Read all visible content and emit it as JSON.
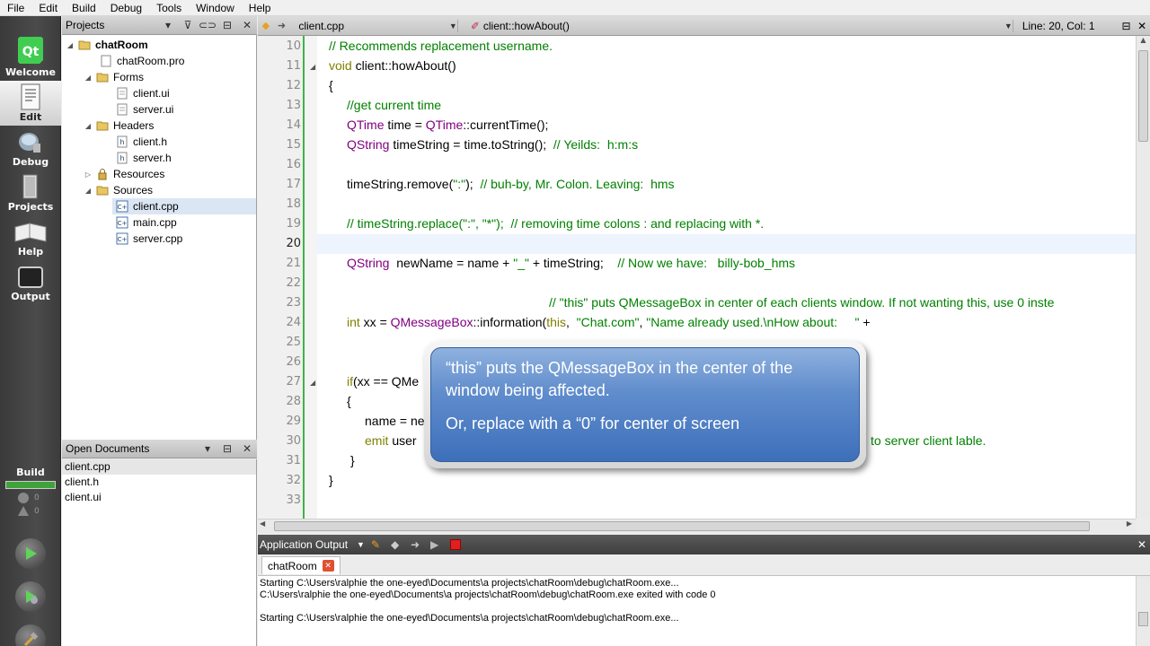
{
  "menu": [
    "File",
    "Edit",
    "Build",
    "Debug",
    "Tools",
    "Window",
    "Help"
  ],
  "modes": [
    {
      "label": "Welcome",
      "icon": "qt-logo-icon"
    },
    {
      "label": "Edit",
      "icon": "edit-document-icon"
    },
    {
      "label": "Debug",
      "icon": "debug-bug-icon"
    },
    {
      "label": "Projects",
      "icon": "projects-icon"
    },
    {
      "label": "Help",
      "icon": "help-book-icon"
    },
    {
      "label": "Output",
      "icon": "output-monitor-icon"
    }
  ],
  "build": {
    "label": "Build",
    "warn_count": "0",
    "error_count": "0"
  },
  "projects_panel": {
    "title": "Projects",
    "tree": [
      {
        "label": "chatRoom"
      },
      {
        "label": "chatRoom.pro"
      },
      {
        "label": "Forms"
      },
      {
        "label": "client.ui"
      },
      {
        "label": "server.ui"
      },
      {
        "label": "Headers"
      },
      {
        "label": "client.h"
      },
      {
        "label": "server.h"
      },
      {
        "label": "Resources"
      },
      {
        "label": "Sources"
      },
      {
        "label": "client.cpp"
      },
      {
        "label": "main.cpp"
      },
      {
        "label": "server.cpp"
      }
    ]
  },
  "open_documents": {
    "title": "Open Documents",
    "items": [
      "client.cpp",
      "client.h",
      "client.ui"
    ]
  },
  "editor_toolbar": {
    "file": "client.cpp",
    "function": "client::howAbout()",
    "position": "Line: 20, Col: 1"
  },
  "editor": {
    "line_numbers": [
      "10",
      "11",
      "12",
      "13",
      "14",
      "15",
      "16",
      "17",
      "18",
      "19",
      "20",
      "21",
      "22",
      "23",
      "24",
      "25",
      "26",
      "27",
      "28",
      "29",
      "30",
      "31",
      "32",
      "33"
    ],
    "current_line": "20"
  },
  "callout": {
    "line1": "“this” puts the QMessageBox in the center of the window being affected.",
    "line2": "Or, replace with a “0” for center of screen"
  },
  "output": {
    "title": "Application Output",
    "tab": "chatRoom",
    "lines": [
      "Starting C:\\Users\\ralphie the one-eyed\\Documents\\a projects\\chatRoom\\debug\\chatRoom.exe...",
      "C:\\Users\\ralphie the one-eyed\\Documents\\a projects\\chatRoom\\debug\\chatRoom.exe exited with code 0",
      "",
      "Starting C:\\Users\\ralphie the one-eyed\\Documents\\a projects\\chatRoom\\debug\\chatRoom.exe..."
    ]
  },
  "code": {
    "l10": "// Recommends replacement username.",
    "l11a": "void",
    "l11b": " client::howAbout()",
    "l12": "{",
    "l13": "//get current time",
    "l14a": "QTime",
    "l14b": " time = ",
    "l14c": "QTime",
    "l14d": "::currentTime();",
    "l15a": "QString",
    "l15b": " timeString = time.toString();  ",
    "l15c": "// Yeilds:  h:m:s",
    "l17a": "timeString.remove(",
    "l17b": "\":\"",
    "l17c": ");  ",
    "l17d": "// buh-by, Mr. Colon. Leaving:  hms",
    "l19": "// timeString.replace(\":\", \"*\");  // removing time colons : and replacing with *.",
    "l21a": "QString",
    "l21b": "  newName = name + ",
    "l21c": "\"_\"",
    "l21d": " + timeString;    ",
    "l21e": "// Now we have:   billy-bob_hms",
    "l23": "// \"this\" puts QMessageBox in center of each clients window. If not wanting this, use 0 inste",
    "l24a": "int",
    "l24b": " xx = ",
    "l24c": "QMessageBox",
    "l24d": "::information(",
    "l24e": "this",
    "l24f": ",  ",
    "l24g": "\"Chat.com\"",
    "l24h": ", ",
    "l24i": "\"Name already used.\\nHow about:     \"",
    "l24j": " +",
    "l27a": "if",
    "l27b": "(xx == QMe",
    "l28": "{",
    "l29": "name = ne",
    "l30a": "emit",
    "l30b": " user",
    "l30c": "to server client lable.",
    "l31": "}",
    "l32": "}"
  }
}
